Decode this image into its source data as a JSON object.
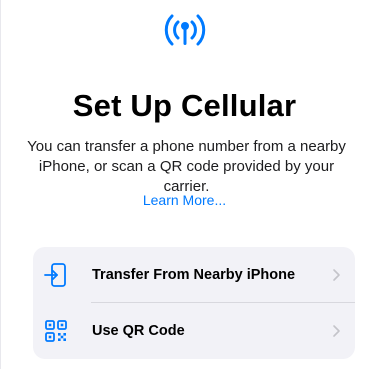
{
  "header": {
    "icon": "cellular-antenna-icon"
  },
  "title": "Set Up Cellular",
  "subtitle": "You can transfer a phone number from a nearby iPhone, or scan a QR code provided by your carrier.",
  "learn_more": "Learn More...",
  "options": [
    {
      "label": "Transfer From Nearby iPhone",
      "icon": "transfer-phone-icon"
    },
    {
      "label": "Use QR Code",
      "icon": "qr-code-icon"
    }
  ],
  "colors": {
    "accent": "#007aff",
    "group_background": "#f2f2f7"
  }
}
